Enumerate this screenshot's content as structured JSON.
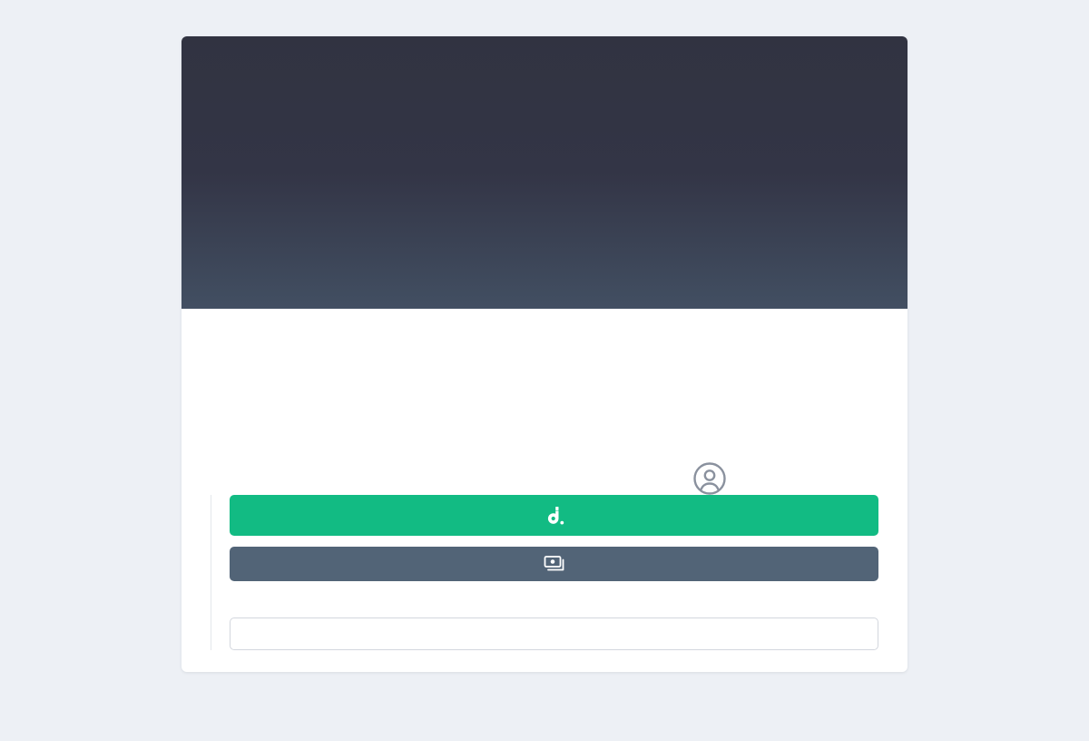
{
  "hero": {},
  "profile": {
    "icon": "user-circle-icon"
  },
  "actions": {
    "primary": {
      "label": "",
      "icon": "deezer-logo-icon",
      "color": "#12bb83"
    },
    "secondary": {
      "label": "",
      "icon": "cash-icon",
      "color": "#526477"
    },
    "input": {
      "value": "",
      "placeholder": ""
    }
  },
  "colors": {
    "page_background": "#edf0f5",
    "hero_top": "#313341",
    "hero_bottom": "#424f62"
  }
}
